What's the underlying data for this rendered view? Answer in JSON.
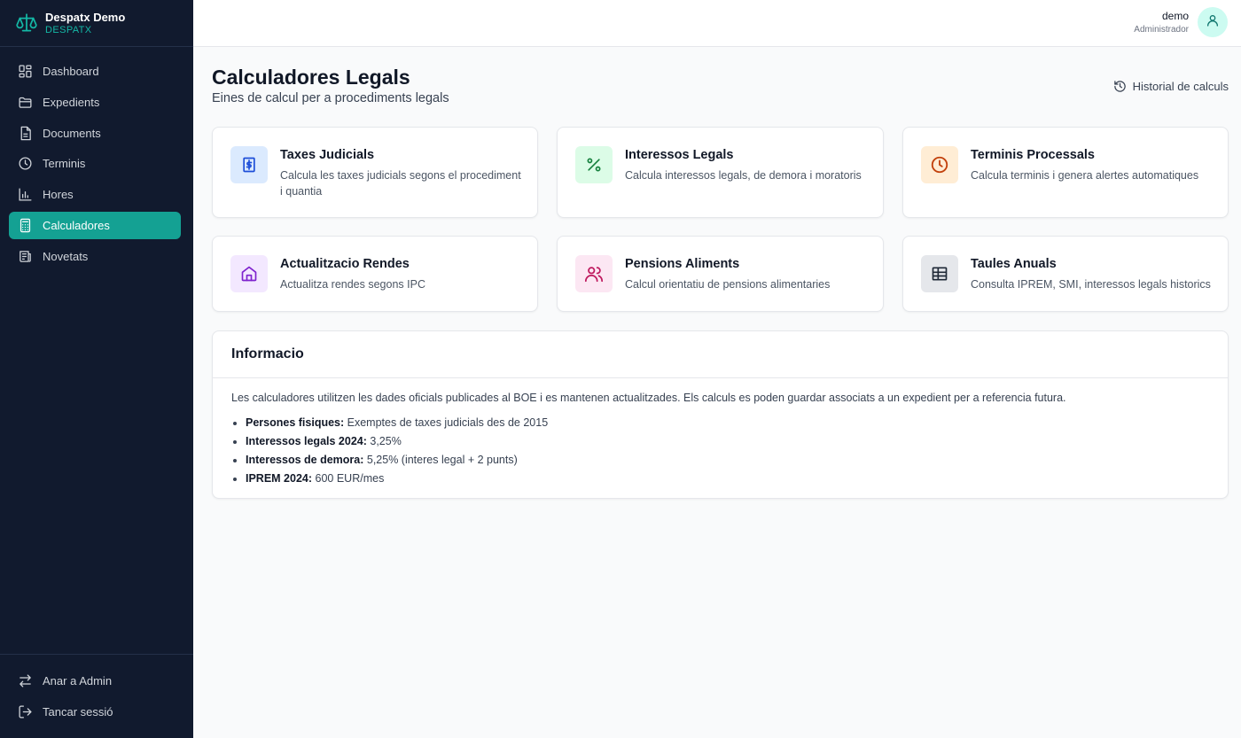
{
  "brand": {
    "name": "Despatx Demo",
    "sub": "DESPATX",
    "icon": "scale-icon"
  },
  "nav": {
    "items": [
      {
        "label": "Dashboard",
        "icon": "dashboard-icon"
      },
      {
        "label": "Expedients",
        "icon": "folder-icon"
      },
      {
        "label": "Documents",
        "icon": "document-icon"
      },
      {
        "label": "Terminis",
        "icon": "clock-icon"
      },
      {
        "label": "Hores",
        "icon": "bar-chart-icon"
      },
      {
        "label": "Calculadores",
        "icon": "calculator-icon",
        "active": true
      },
      {
        "label": "Novetats",
        "icon": "news-icon"
      }
    ],
    "bottom": [
      {
        "label": "Anar a Admin",
        "icon": "swap-icon"
      },
      {
        "label": "Tancar sessió",
        "icon": "logout-icon"
      }
    ]
  },
  "user": {
    "name": "demo",
    "role": "Administrador"
  },
  "page": {
    "title": "Calculadores Legals",
    "subtitle": "Eines de calcul per a procediments legals",
    "history": "Historial de calculs"
  },
  "cards": [
    {
      "title": "Taxes Judicials",
      "desc": "Calcula les taxes judicials segons el procediment i quantia",
      "icon": "receipt-dollar-icon",
      "bg": "#dbeafe",
      "fg": "#1d4ed8"
    },
    {
      "title": "Interessos Legals",
      "desc": "Calcula interessos legals, de demora i moratoris",
      "icon": "percent-icon",
      "bg": "#dcfce7",
      "fg": "#15803d"
    },
    {
      "title": "Terminis Processals",
      "desc": "Calcula terminis i genera alertes automatiques",
      "icon": "clock-icon",
      "bg": "#ffedd5",
      "fg": "#c2410c"
    },
    {
      "title": "Actualitzacio Rendes",
      "desc": "Actualitza rendes segons IPC",
      "icon": "home-icon",
      "bg": "#f3e8ff",
      "fg": "#7e22ce"
    },
    {
      "title": "Pensions Aliments",
      "desc": "Calcul orientatiu de pensions alimentaries",
      "icon": "users-icon",
      "bg": "#fce7f3",
      "fg": "#be185d"
    },
    {
      "title": "Taules Anuals",
      "desc": "Consulta IPREM, SMI, interessos legals historics",
      "icon": "table-icon",
      "bg": "#e5e7eb",
      "fg": "#1f2937"
    }
  ],
  "info": {
    "title": "Informacio",
    "intro": "Les calculadores utilitzen les dades oficials publicades al BOE i es mantenen actualitzades. Els calculs es poden guardar associats a un expedient per a referencia futura.",
    "items": [
      {
        "label": "Persones fisiques:",
        "value": "Exemptes de taxes judicials des de 2015"
      },
      {
        "label": "Interessos legals 2024:",
        "value": "3,25%"
      },
      {
        "label": "Interessos de demora:",
        "value": "5,25% (interes legal + 2 punts)"
      },
      {
        "label": "IPREM 2024:",
        "value": "600 EUR/mes"
      }
    ]
  }
}
